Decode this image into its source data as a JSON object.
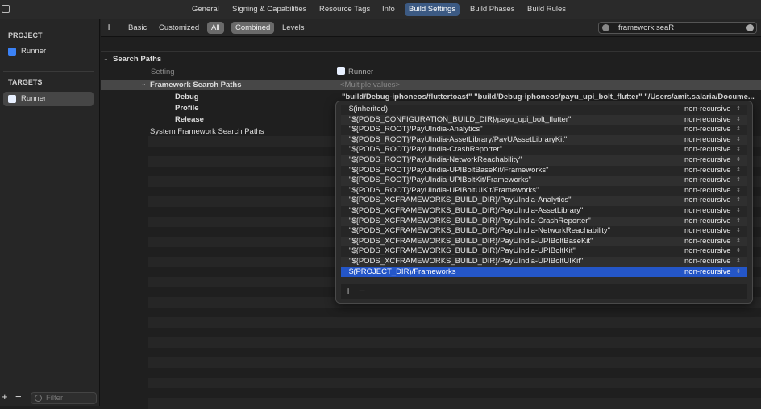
{
  "tabs": [
    "General",
    "Signing & Capabilities",
    "Resource Tags",
    "Info",
    "Build Settings",
    "Build Phases",
    "Build Rules"
  ],
  "sidebar": {
    "project_header": "PROJECT",
    "project_item": "Runner",
    "targets_header": "TARGETS",
    "target_item": "Runner",
    "filter_placeholder": "Filter"
  },
  "toolbar": {
    "basic": "Basic",
    "customized": "Customized",
    "all": "All",
    "combined": "Combined",
    "levels": "Levels",
    "search_value": "framework seaR"
  },
  "section": {
    "title": "Search Paths",
    "setting_col": "Setting",
    "target_col": "Runner"
  },
  "settings": {
    "framework_search_paths": "Framework Search Paths",
    "multiple_values": "<Multiple values>",
    "debug": "Debug",
    "debug_value": "\"build/Debug-iphoneos/fluttertoast\" \"build/Debug-iphoneos/payu_upi_bolt_flutter\" \"/Users/amit.salaria/Docume...",
    "profile": "Profile",
    "release": "Release",
    "system_framework_search_paths": "System Framework Search Paths"
  },
  "popover": {
    "rows": [
      {
        "path": "$(inherited)",
        "mode": "non-recursive"
      },
      {
        "path": "\"${PODS_CONFIGURATION_BUILD_DIR}/payu_upi_bolt_flutter\"",
        "mode": "non-recursive"
      },
      {
        "path": "\"${PODS_ROOT}/PayUIndia-Analytics\"",
        "mode": "non-recursive"
      },
      {
        "path": "\"${PODS_ROOT}/PayUIndia-AssetLibrary/PayUAssetLibraryKit\"",
        "mode": "non-recursive"
      },
      {
        "path": "\"${PODS_ROOT}/PayUIndia-CrashReporter\"",
        "mode": "non-recursive"
      },
      {
        "path": "\"${PODS_ROOT}/PayUIndia-NetworkReachability\"",
        "mode": "non-recursive"
      },
      {
        "path": "\"${PODS_ROOT}/PayUIndia-UPIBoltBaseKit/Frameworks\"",
        "mode": "non-recursive"
      },
      {
        "path": "\"${PODS_ROOT}/PayUIndia-UPIBoltKit/Frameworks\"",
        "mode": "non-recursive"
      },
      {
        "path": "\"${PODS_ROOT}/PayUIndia-UPIBoltUIKit/Frameworks\"",
        "mode": "non-recursive"
      },
      {
        "path": "\"${PODS_XCFRAMEWORKS_BUILD_DIR}/PayUIndia-Analytics\"",
        "mode": "non-recursive"
      },
      {
        "path": "\"${PODS_XCFRAMEWORKS_BUILD_DIR}/PayUIndia-AssetLibrary\"",
        "mode": "non-recursive"
      },
      {
        "path": "\"${PODS_XCFRAMEWORKS_BUILD_DIR}/PayUIndia-CrashReporter\"",
        "mode": "non-recursive"
      },
      {
        "path": "\"${PODS_XCFRAMEWORKS_BUILD_DIR}/PayUIndia-NetworkReachability\"",
        "mode": "non-recursive"
      },
      {
        "path": "\"${PODS_XCFRAMEWORKS_BUILD_DIR}/PayUIndia-UPIBoltBaseKit\"",
        "mode": "non-recursive"
      },
      {
        "path": "\"${PODS_XCFRAMEWORKS_BUILD_DIR}/PayUIndia-UPIBoltKit\"",
        "mode": "non-recursive"
      },
      {
        "path": "\"${PODS_XCFRAMEWORKS_BUILD_DIR}/PayUIndia-UPIBoltUIKit\"",
        "mode": "non-recursive"
      },
      {
        "path": "$(PROJECT_DIR)/Frameworks",
        "mode": "non-recursive",
        "selected": true
      }
    ]
  }
}
